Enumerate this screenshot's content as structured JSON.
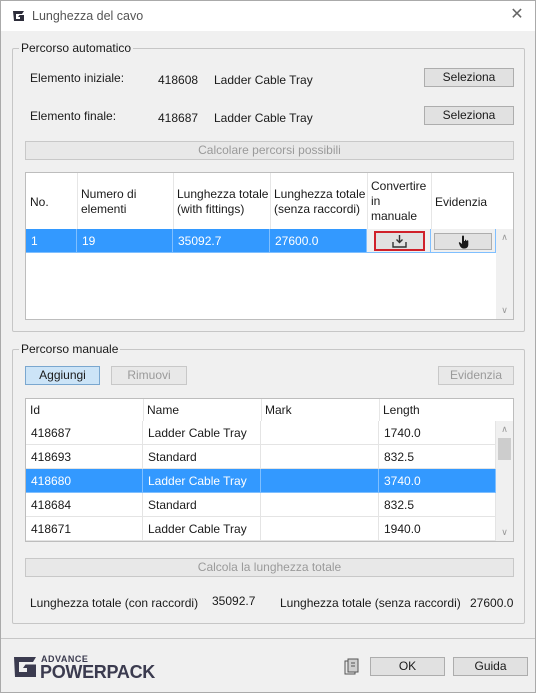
{
  "window": {
    "title": "Lunghezza del cavo",
    "close_icon": "close-icon",
    "app_icon": "graitec-logo-icon"
  },
  "auto": {
    "legend": "Percorso automatico",
    "start_label": "Elemento iniziale:",
    "start_id": "418608",
    "start_name": "Ladder Cable Tray",
    "end_label": "Elemento finale:",
    "end_id": "418687",
    "end_name": "Ladder Cable Tray",
    "select_label": "Seleziona",
    "compute_label": "Calcolare percorsi possibili",
    "grid": {
      "headers": [
        "No.",
        "Numero di elementi",
        "Lunghezza totale (with fittings)",
        "Lunghezza totale (senza raccordi)",
        "Convertire in manuale",
        "Evidenzia"
      ],
      "rows": [
        {
          "no": "1",
          "count": "19",
          "with": "35092.7",
          "without": "27600.0",
          "convert_icon": "download-icon",
          "highlight_icon": "hand-pointer-icon"
        }
      ]
    }
  },
  "manual": {
    "legend": "Percorso manuale",
    "add_label": "Aggiungi",
    "remove_label": "Rimuovi",
    "highlight_label": "Evidenzia",
    "grid": {
      "headers": [
        "Id",
        "Name",
        "Mark",
        "Length"
      ],
      "rows": [
        {
          "id": "418687",
          "name": "Ladder Cable Tray",
          "mark": "",
          "length": "1740.0",
          "selected": false
        },
        {
          "id": "418693",
          "name": "Standard",
          "mark": "",
          "length": "832.5",
          "selected": false
        },
        {
          "id": "418680",
          "name": "Ladder Cable Tray",
          "mark": "",
          "length": "3740.0",
          "selected": true
        },
        {
          "id": "418684",
          "name": "Standard",
          "mark": "",
          "length": "832.5",
          "selected": false
        },
        {
          "id": "418671",
          "name": "Ladder Cable Tray",
          "mark": "",
          "length": "1940.0",
          "selected": false
        }
      ]
    },
    "compute_total_label": "Calcola la lunghezza totale",
    "total_with_label": "Lunghezza totale (con raccordi)",
    "total_with_value": "35092.7",
    "total_without_label": "Lunghezza totale (senza raccordi)",
    "total_without_value": "27600.0"
  },
  "footer": {
    "brand_small": "ADVANCE",
    "brand_big": "POWERPACK",
    "book_icon": "help-book-icon",
    "ok_label": "OK",
    "guide_label": "Guida"
  },
  "colors": {
    "selection": "#3399ff",
    "highlight_border": "#d0202a",
    "brand": "#3b3b4f"
  }
}
